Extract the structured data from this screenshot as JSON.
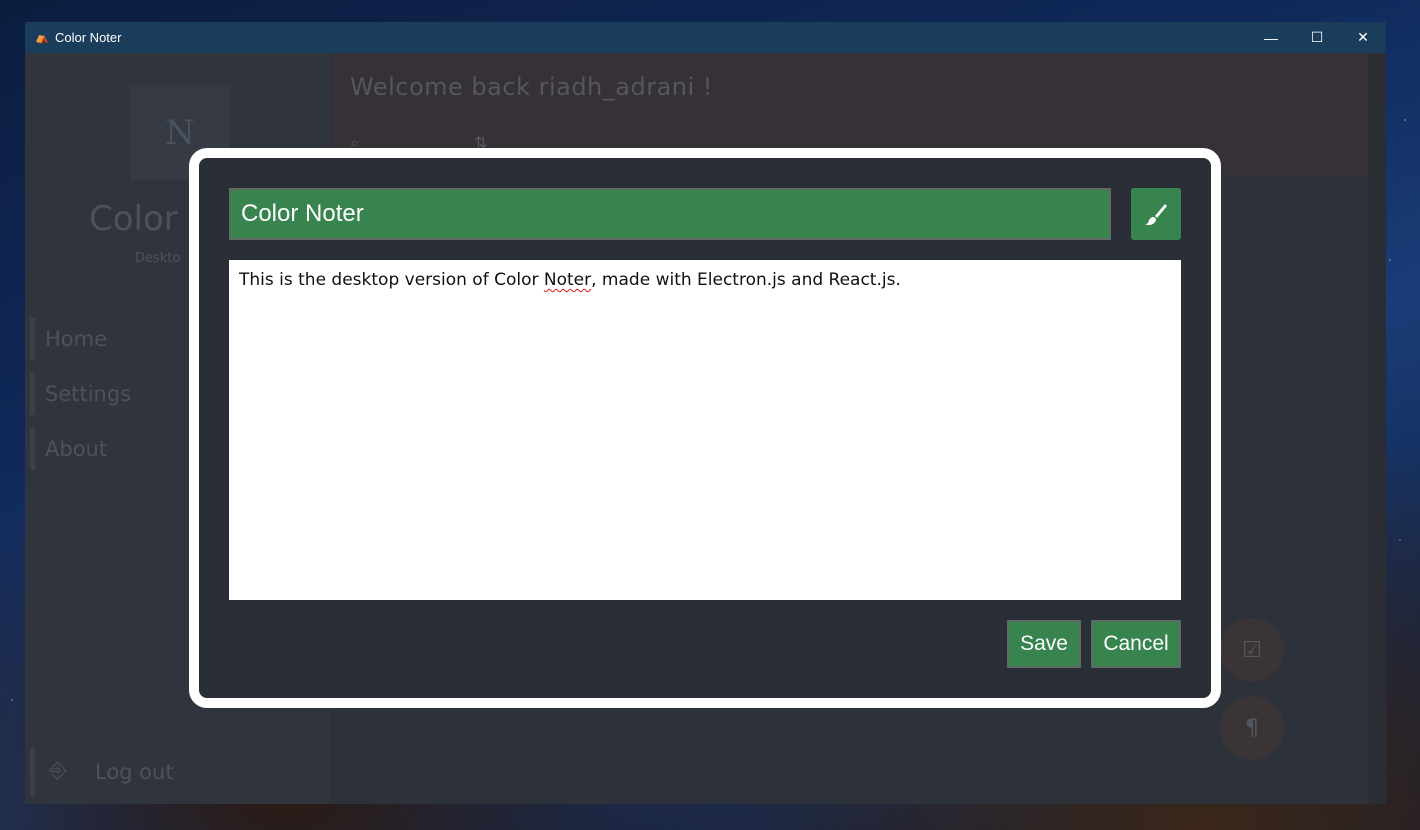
{
  "window": {
    "title": "Color Noter",
    "controls": {
      "minimize": "—",
      "maximize": "☐",
      "close": "✕"
    }
  },
  "sidebar": {
    "logo_glyph": "N",
    "app_title": "Color N",
    "app_subtitle": "Deskto",
    "nav": [
      {
        "label": "Home"
      },
      {
        "label": "Settings"
      },
      {
        "label": "About"
      }
    ],
    "logout_label": "Log out"
  },
  "header": {
    "welcome": "Welcome back riadh_adrani !"
  },
  "modal": {
    "title_value": "Color Noter",
    "note_prefix": "This is the desktop version of Color ",
    "note_misspelled": "Noter",
    "note_suffix": ", made with Electron.js and React.js.",
    "save_label": "Save",
    "cancel_label": "Cancel",
    "accent_color": "#37844f",
    "brush_icon": "paint-brush-icon"
  },
  "fabs": [
    {
      "icon": "checkbox-icon"
    },
    {
      "icon": "paragraph-icon"
    }
  ]
}
